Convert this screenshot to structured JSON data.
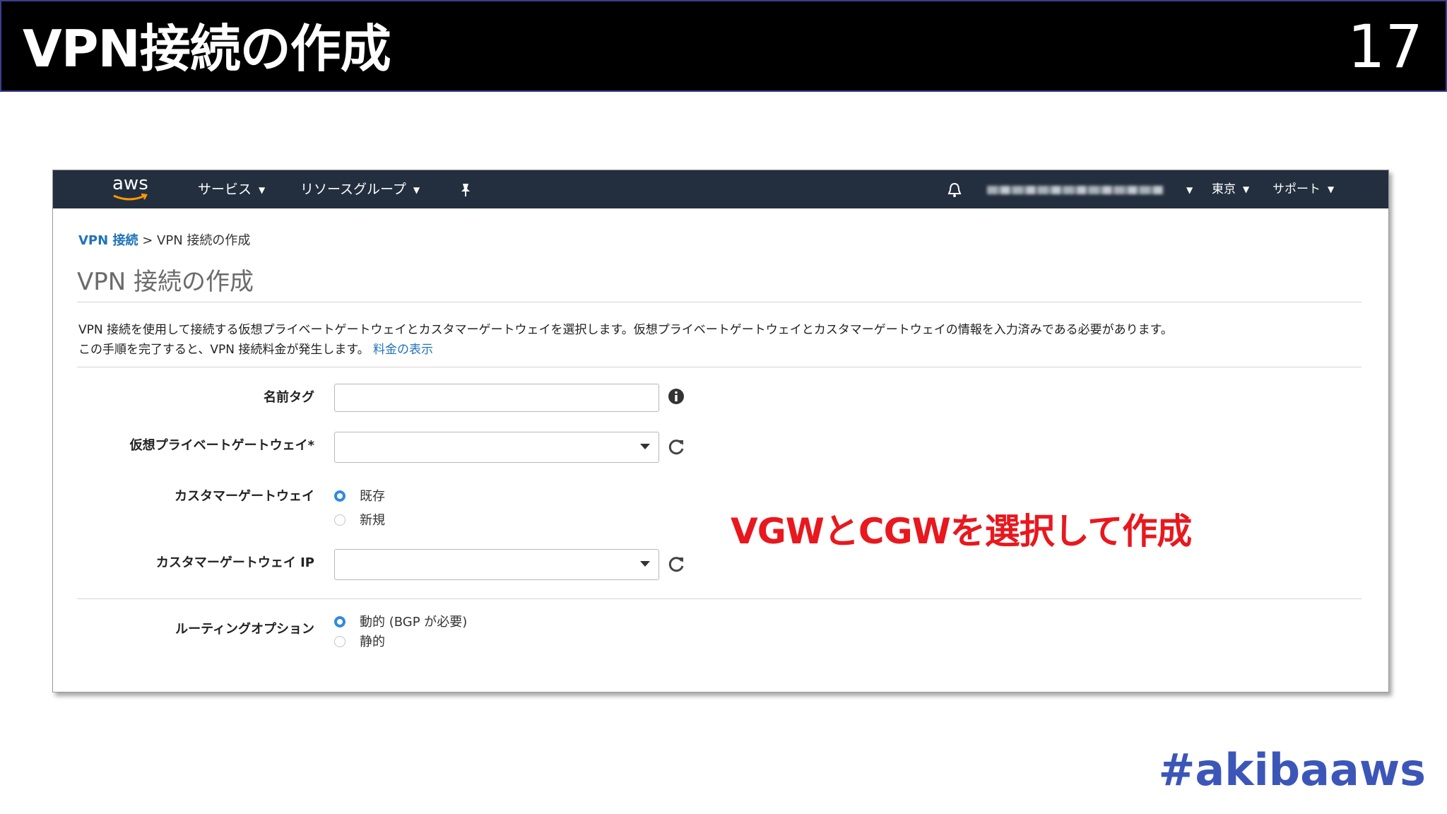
{
  "slide": {
    "title": "VPN接続の作成",
    "page_number": "17",
    "hashtag": "#akibaaws",
    "caption": "VGWとCGWを選択して作成",
    "caption_color": "#e8181e"
  },
  "navbar": {
    "logo_text": "aws",
    "services": "サービス",
    "resource_groups": "リソースグループ",
    "region": "東京",
    "support": "サポート",
    "icons": [
      "pin-icon",
      "bell-icon"
    ],
    "background": "#232f3e"
  },
  "breadcrumb": {
    "parent": "VPN 接続",
    "separator": ">",
    "current": "VPN 接続の作成"
  },
  "page": {
    "title": "VPN 接続の作成",
    "description_line1": "VPN 接続を使用して接続する仮想プライベートゲートウェイとカスタマーゲートウェイを選択します。仮想プライベートゲートウェイとカスタマーゲートウェイの情報を入力済みである必要があります。",
    "description_line2": "この手順を完了すると、VPN 接続料金が発生します。",
    "pricing_link": "料金の表示"
  },
  "form": {
    "name_tag_label": "名前タグ",
    "name_tag_value": "",
    "vgw_label": "仮想プライベートゲートウェイ*",
    "vgw_value": "",
    "cgw_label": "カスタマーゲートウェイ",
    "cgw_options": [
      {
        "label": "既存",
        "selected": true
      },
      {
        "label": "新規",
        "selected": false
      }
    ],
    "cgw_ip_label": "カスタマーゲートウェイ IP",
    "cgw_ip_value": "",
    "routing_label": "ルーティングオプション",
    "routing_options": [
      {
        "label": "動的 (BGP が必要)",
        "selected": true
      },
      {
        "label": "静的",
        "selected": false
      }
    ]
  }
}
